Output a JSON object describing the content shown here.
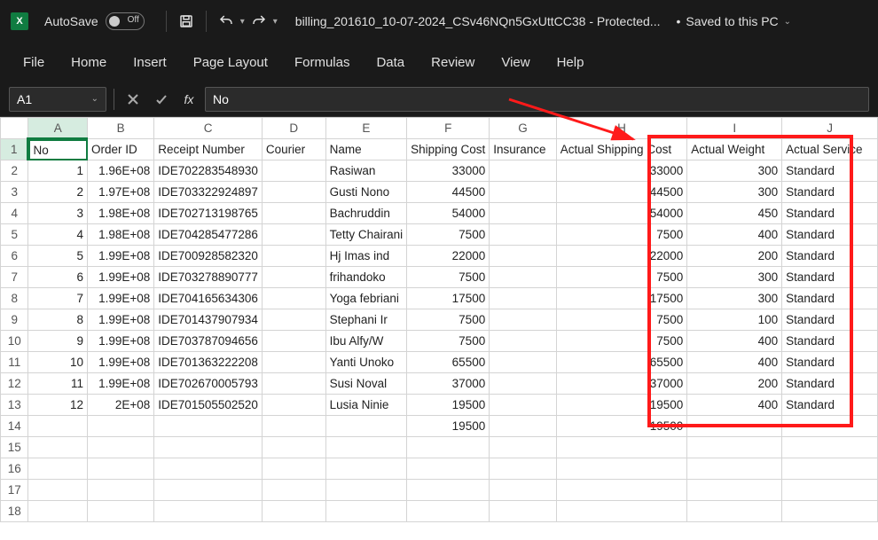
{
  "titlebar": {
    "autosave_label": "AutoSave",
    "autosave_state": "Off",
    "doc_title": "billing_201610_10-07-2024_CSv46NQn5GxUttCC38  -  Protected...",
    "saved_label": "Saved to this PC"
  },
  "tabs": [
    "File",
    "Home",
    "Insert",
    "Page Layout",
    "Formulas",
    "Data",
    "Review",
    "View",
    "Help"
  ],
  "namebox": "A1",
  "formula_value": "No",
  "columns": [
    {
      "letter": "A",
      "width": 80
    },
    {
      "letter": "B",
      "width": 78
    },
    {
      "letter": "C",
      "width": 78
    },
    {
      "letter": "D",
      "width": 78
    },
    {
      "letter": "E",
      "width": 78
    },
    {
      "letter": "F",
      "width": 78
    },
    {
      "letter": "G",
      "width": 78
    },
    {
      "letter": "H",
      "width": 152
    },
    {
      "letter": "I",
      "width": 112
    },
    {
      "letter": "J",
      "width": 112
    }
  ],
  "headers": [
    "No",
    "Order ID",
    "Receipt Number",
    "Courier",
    "Name",
    "Shipping Cost",
    "Insurance",
    "Actual Shipping Cost",
    "Actual Weight",
    "Actual Service"
  ],
  "rows": [
    {
      "n": 1,
      "no": "1",
      "oid": "1.96E+08",
      "rc": "IDE702283548930",
      "cr": "",
      "nm": "Rasiwan",
      "sc": "33000",
      "ins": "",
      "asc": "33000",
      "aw": "300",
      "svc": "Standard"
    },
    {
      "n": 2,
      "no": "2",
      "oid": "1.97E+08",
      "rc": "IDE703322924897",
      "cr": "",
      "nm": "Gusti Nono",
      "sc": "44500",
      "ins": "",
      "asc": "44500",
      "aw": "300",
      "svc": "Standard"
    },
    {
      "n": 3,
      "no": "3",
      "oid": "1.98E+08",
      "rc": "IDE702713198765",
      "cr": "",
      "nm": "Bachruddin",
      "sc": "54000",
      "ins": "",
      "asc": "54000",
      "aw": "450",
      "svc": "Standard"
    },
    {
      "n": 4,
      "no": "4",
      "oid": "1.98E+08",
      "rc": "IDE704285477286",
      "cr": "",
      "nm": "Tetty Chairani",
      "sc": "7500",
      "ins": "",
      "asc": "7500",
      "aw": "400",
      "svc": "Standard"
    },
    {
      "n": 5,
      "no": "5",
      "oid": "1.99E+08",
      "rc": "IDE700928582320",
      "cr": "",
      "nm": "Hj Imas ind",
      "sc": "22000",
      "ins": "",
      "asc": "22000",
      "aw": "200",
      "svc": "Standard"
    },
    {
      "n": 6,
      "no": "6",
      "oid": "1.99E+08",
      "rc": "IDE703278890777",
      "cr": "",
      "nm": "frihandoko",
      "sc": "7500",
      "ins": "",
      "asc": "7500",
      "aw": "300",
      "svc": "Standard"
    },
    {
      "n": 7,
      "no": "7",
      "oid": "1.99E+08",
      "rc": "IDE704165634306",
      "cr": "",
      "nm": "Yoga febriani",
      "sc": "17500",
      "ins": "",
      "asc": "17500",
      "aw": "300",
      "svc": "Standard"
    },
    {
      "n": 8,
      "no": "8",
      "oid": "1.99E+08",
      "rc": "IDE701437907934",
      "cr": "",
      "nm": "Stephani Ir",
      "sc": "7500",
      "ins": "",
      "asc": "7500",
      "aw": "100",
      "svc": "Standard"
    },
    {
      "n": 9,
      "no": "9",
      "oid": "1.99E+08",
      "rc": "IDE703787094656",
      "cr": "",
      "nm": "Ibu Alfy/W",
      "sc": "7500",
      "ins": "",
      "asc": "7500",
      "aw": "400",
      "svc": "Standard"
    },
    {
      "n": 10,
      "no": "10",
      "oid": "1.99E+08",
      "rc": "IDE701363222208",
      "cr": "",
      "nm": "Yanti Unoko",
      "sc": "65500",
      "ins": "",
      "asc": "65500",
      "aw": "400",
      "svc": "Standard"
    },
    {
      "n": 11,
      "no": "11",
      "oid": "1.99E+08",
      "rc": "IDE702670005793",
      "cr": "",
      "nm": "Susi Noval",
      "sc": "37000",
      "ins": "",
      "asc": "37000",
      "aw": "200",
      "svc": "Standard"
    },
    {
      "n": 12,
      "no": "12",
      "oid": "2E+08",
      "rc": "IDE701505502520",
      "cr": "",
      "nm": "Lusia Ninie",
      "sc": "19500",
      "ins": "",
      "asc": "19500",
      "aw": "400",
      "svc": "Standard"
    },
    {
      "n": 13,
      "no": "",
      "oid": "",
      "rc": "",
      "cr": "",
      "nm": "",
      "sc": "19500",
      "ins": "",
      "asc": "19500",
      "aw": "",
      "svc": ""
    }
  ],
  "empty_rows": [
    15,
    16,
    17,
    18
  ],
  "chart_data": {
    "type": "table",
    "note": "spreadsheet data embedded in rows above"
  }
}
